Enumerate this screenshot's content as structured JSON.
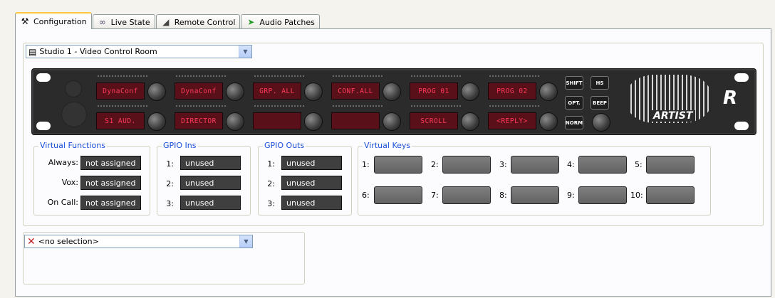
{
  "tabs": [
    {
      "label": "Configuration",
      "icon": "tools-icon"
    },
    {
      "label": "Live State",
      "icon": "glasses-icon"
    },
    {
      "label": "Remote Control",
      "icon": "remote-control-icon"
    },
    {
      "label": "Audio Patches",
      "icon": "audio-patches-icon"
    }
  ],
  "panel_select": {
    "value": "Studio 1 - Video Control Room",
    "icon": "panel-device-icon"
  },
  "device": {
    "displays_top": [
      "DynaConf",
      "DynaConf",
      "GRP. ALL",
      "CONF.ALL",
      "PROG 01",
      "PROG 02"
    ],
    "displays_bottom": [
      "S1 AUD.",
      "DIRECTOR",
      "",
      "",
      "SCROLL",
      "<REPLY>"
    ],
    "buttons": {
      "shift": "SHIFT",
      "hs": "HS",
      "opt": "OPT.",
      "beep": "BEEP",
      "norm": "NORM"
    },
    "brand": "ARTIST",
    "logo": "R"
  },
  "virtual_functions": {
    "title": "Virtual Functions",
    "rows": [
      {
        "label": "Always:",
        "value": "not assigned"
      },
      {
        "label": "Vox:",
        "value": "not assigned"
      },
      {
        "label": "On Call:",
        "value": "not assigned"
      }
    ]
  },
  "gpio_ins": {
    "title": "GPIO Ins",
    "rows": [
      {
        "label": "1:",
        "value": "unused"
      },
      {
        "label": "2:",
        "value": "unused"
      },
      {
        "label": "3:",
        "value": "unused"
      }
    ]
  },
  "gpio_outs": {
    "title": "GPIO Outs",
    "rows": [
      {
        "label": "1:",
        "value": "unused"
      },
      {
        "label": "2:",
        "value": "unused"
      },
      {
        "label": "3:",
        "value": "unused"
      }
    ]
  },
  "virtual_keys": {
    "title": "Virtual Keys",
    "keys": [
      "1:",
      "2:",
      "3:",
      "4:",
      "5:",
      "6:",
      "7:",
      "8:",
      "9:",
      "10:"
    ]
  },
  "selection": {
    "value": "<no selection>",
    "icon": "red-x-icon"
  },
  "colors": {
    "lcd_text": "#ff3a5a",
    "lcd_bg": "#591019",
    "legend": "#1b4fd8",
    "active_tab": "#ffc83c"
  }
}
